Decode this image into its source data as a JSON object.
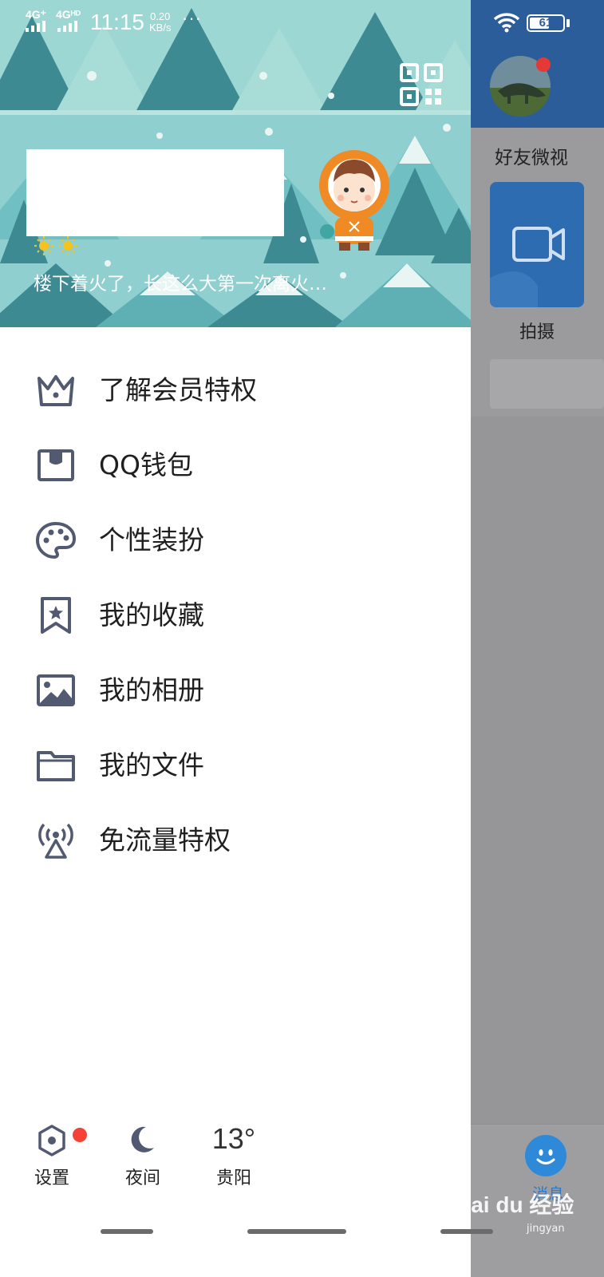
{
  "status_bar": {
    "network_1": "4G⁺",
    "network_2": "4Gᴴᴰ",
    "time": "11:15",
    "speed_value": "0.20",
    "speed_unit": "KB/s",
    "more": "···",
    "battery": "61",
    "battery_level": 0.61
  },
  "profile": {
    "signature": "楼下着火了，长这么大第一次离火…"
  },
  "menu": {
    "items": [
      {
        "label": "了解会员特权",
        "icon": "crown-icon"
      },
      {
        "label": "QQ钱包",
        "icon": "wallet-icon"
      },
      {
        "label": "个性装扮",
        "icon": "palette-icon"
      },
      {
        "label": "我的收藏",
        "icon": "bookmark-star-icon"
      },
      {
        "label": "我的相册",
        "icon": "photo-album-icon"
      },
      {
        "label": "我的文件",
        "icon": "folder-icon"
      },
      {
        "label": "免流量特权",
        "icon": "signal-tower-icon"
      }
    ]
  },
  "bottom": {
    "settings_label": "设置",
    "night_label": "夜间",
    "temperature": "13°",
    "city": "贵阳"
  },
  "main_screen": {
    "friend_video_title": "好友微视",
    "shoot_label": "拍摄",
    "messages_label": "消息",
    "watermark": "Bai du 经验",
    "watermark_sub": "jingyan"
  },
  "colors": {
    "header_sky": "#8fcfd0",
    "tree_dark": "#3e8a93",
    "tree_light": "#9fd6d0",
    "icon_stroke": "#525a72",
    "accent_blue": "#2e89d8",
    "badge_red": "#f44336"
  }
}
